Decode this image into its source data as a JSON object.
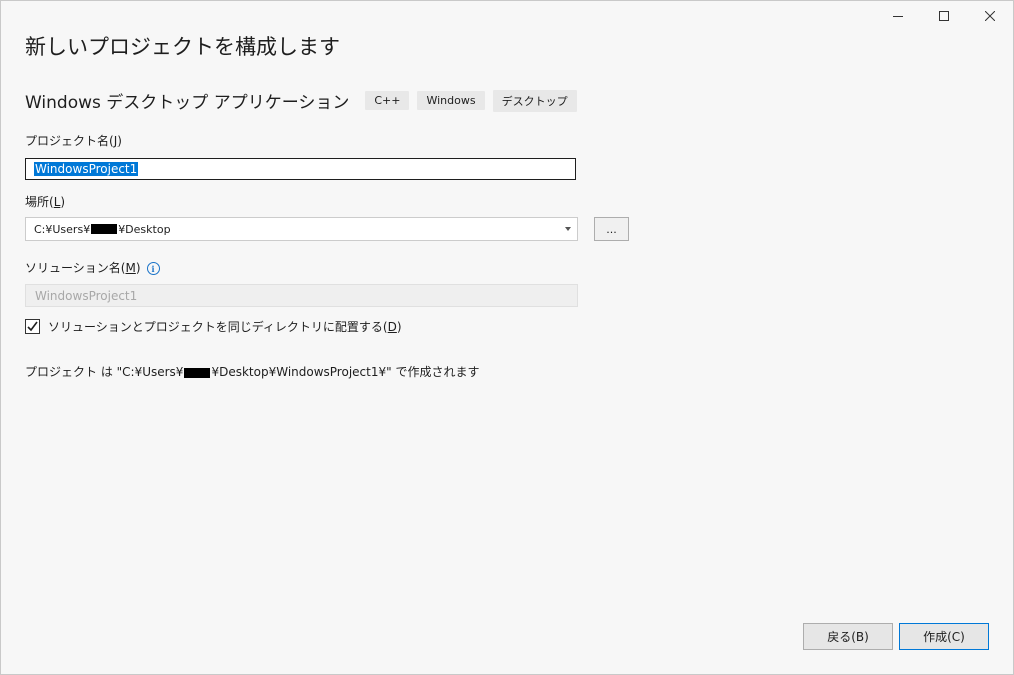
{
  "window": {
    "controls": [
      "minimize",
      "maximize",
      "close"
    ]
  },
  "page": {
    "title": "新しいプロジェクトを構成します"
  },
  "template": {
    "name": "Windows デスクトップ アプリケーション",
    "tags": [
      "C++",
      "Windows",
      "デスクトップ"
    ]
  },
  "project_name": {
    "label": "プロジェクト名(",
    "mnemonic": "J",
    "label_end": ")",
    "value": "WindowsProject1"
  },
  "location": {
    "label": "場所(",
    "mnemonic": "L",
    "label_end": ")",
    "value_prefix": "C:¥Users¥",
    "value_suffix": "¥Desktop",
    "browse_label": "..."
  },
  "solution_name": {
    "label": "ソリューション名(",
    "mnemonic": "M",
    "label_end": ")",
    "value": "WindowsProject1"
  },
  "same_dir_checkbox": {
    "checked": true,
    "label": "ソリューションとプロジェクトを同じディレクトリに配置する(",
    "mnemonic": "D",
    "label_end": ")"
  },
  "summary": {
    "prefix": "プロジェクト は \"C:¥Users¥",
    "suffix": "¥Desktop¥WindowsProject1¥\" で作成されます"
  },
  "buttons": {
    "back": "戻る(B)",
    "create": "作成(C)"
  },
  "colors": {
    "selection": "#0078d7",
    "info_icon": "#1a73c8"
  }
}
